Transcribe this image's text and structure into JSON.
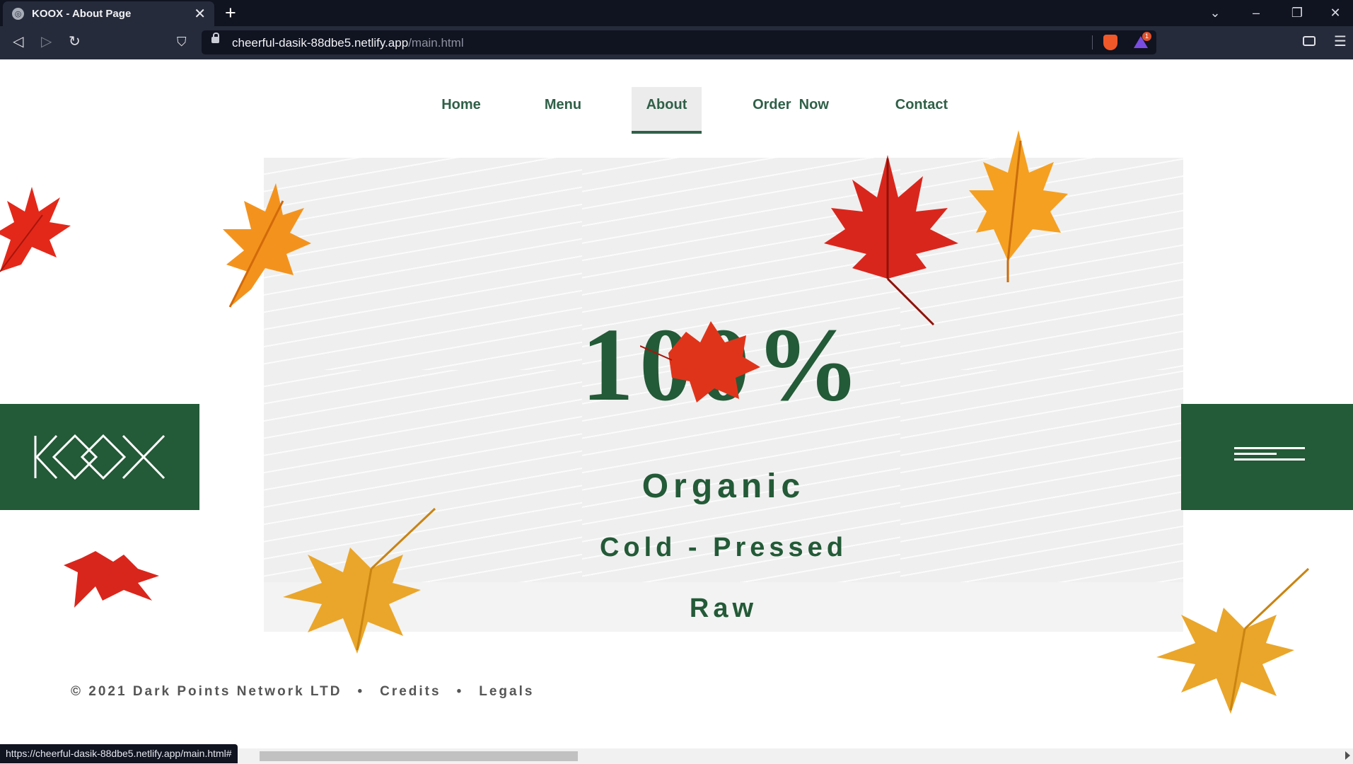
{
  "browser": {
    "tab_title": "KOOX - About Page",
    "tab_close": "✕",
    "new_tab": "+",
    "url_host": "cheerful-dasik-88dbe5.netlify.app",
    "url_path": "/main.html",
    "rewards_count": "1",
    "status_url": "https://cheerful-dasik-88dbe5.netlify.app/main.html#"
  },
  "nav": {
    "items": [
      {
        "label": "Home",
        "active": false
      },
      {
        "label": "Menu",
        "active": false
      },
      {
        "label": "About",
        "active": true
      },
      {
        "label": "Order  Now",
        "active": false
      },
      {
        "label": "Contact",
        "active": false
      }
    ]
  },
  "hero": {
    "headline": "100%",
    "line1": "Organic",
    "line2": "Cold - Pressed",
    "line3": "Raw"
  },
  "logo": {
    "text": "KOOX"
  },
  "footer": {
    "copyright": "© 2021 Dark Points Network LTD",
    "separator": "•",
    "credits": "Credits",
    "legals": "Legals"
  },
  "colors": {
    "brand_green": "#235a37",
    "nav_green": "#2f6048",
    "leaf_red": "#d9261c",
    "leaf_orange": "#f28c1a",
    "leaf_yellow": "#eaa62a"
  }
}
